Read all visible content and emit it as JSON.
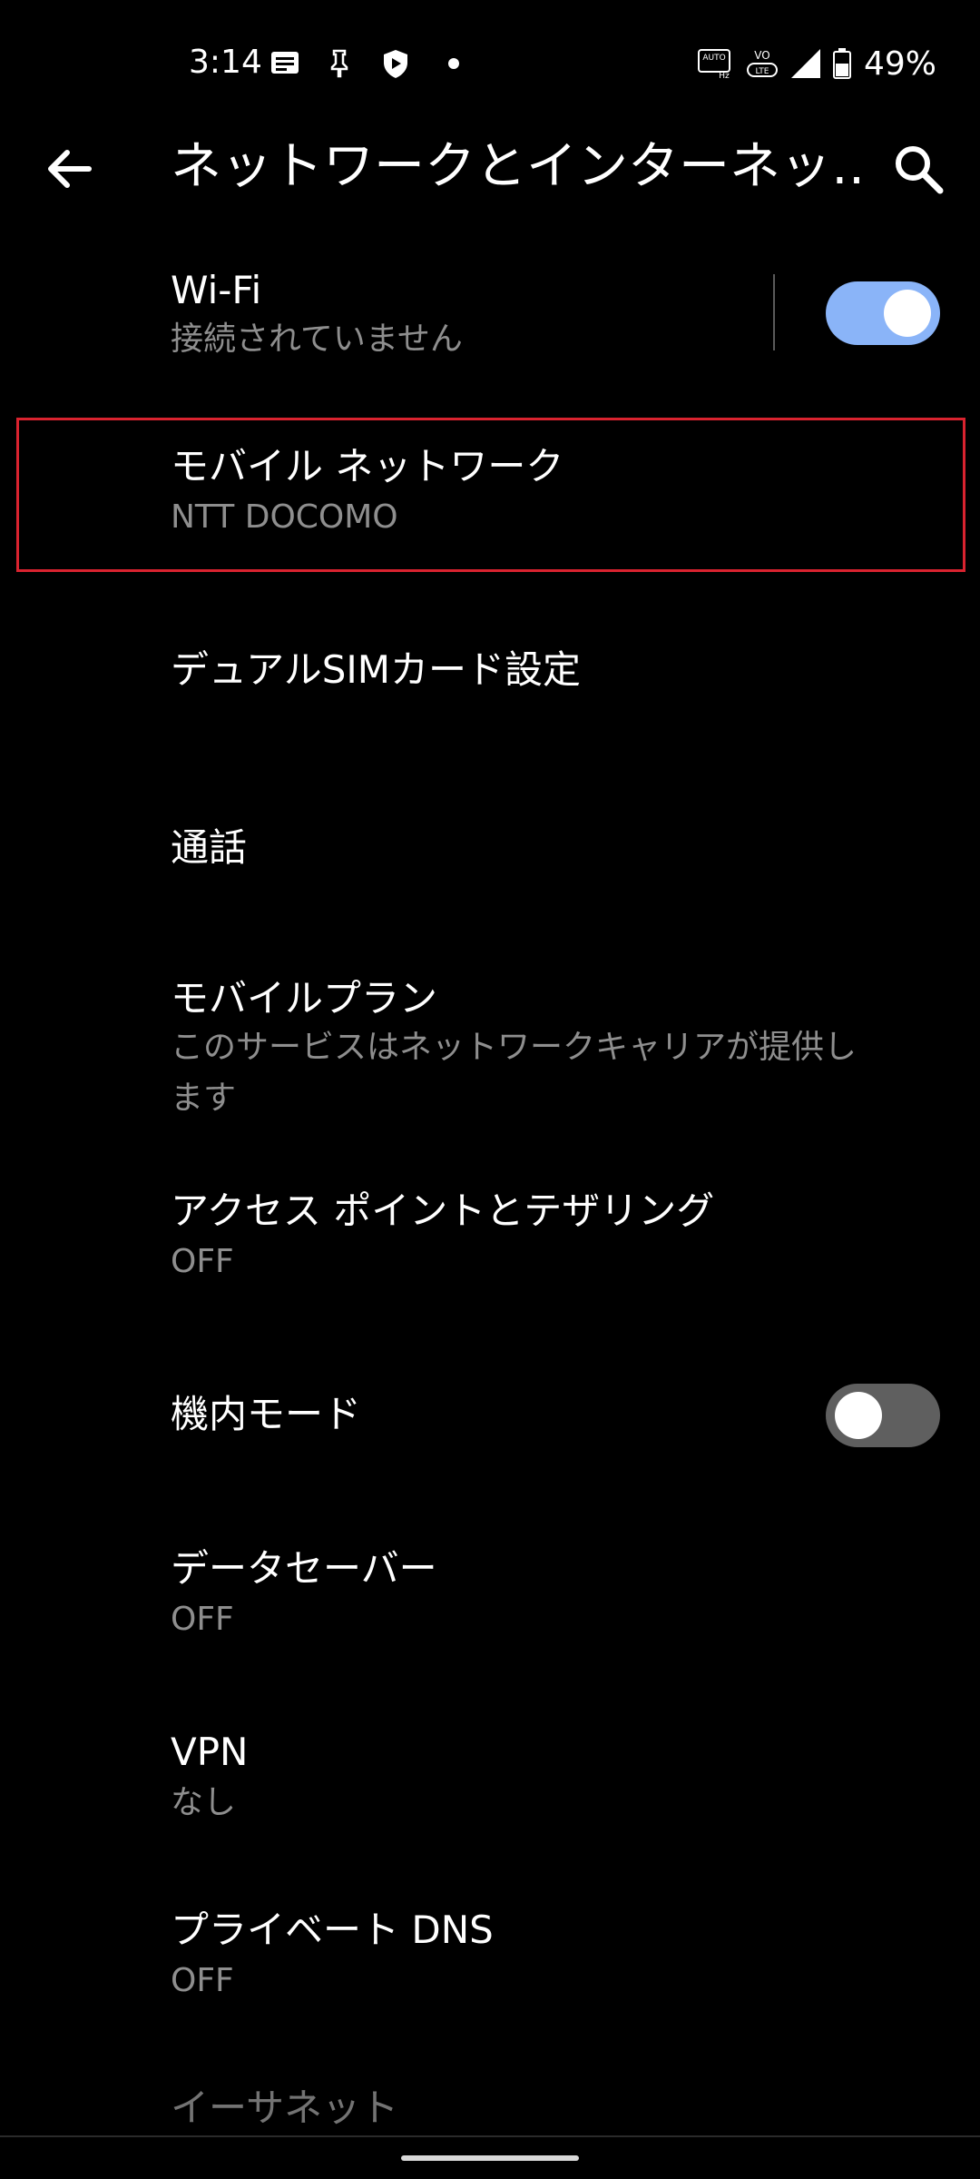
{
  "status_bar": {
    "time": "3:14",
    "battery_percent": "49%",
    "icons": [
      "message-icon",
      "pin-icon",
      "shield-icon",
      "dot-icon",
      "auto-hz-icon",
      "volte-icon",
      "signal-icon",
      "battery-icon"
    ]
  },
  "toolbar": {
    "title": "ネットワークとインターネッ…",
    "back_icon": "arrow-back-icon",
    "search_icon": "search-icon"
  },
  "settings": {
    "wifi": {
      "title": "Wi-Fi",
      "summary": "接続されていません",
      "toggle_on": true
    },
    "mobile_network": {
      "title": "モバイル ネットワーク",
      "summary": "NTT DOCOMO"
    },
    "dual_sim": {
      "title": "デュアルSIMカード設定"
    },
    "calls": {
      "title": "通話"
    },
    "mobile_plan": {
      "title": "モバイルプラン",
      "summary_line1": "このサービスはネットワークキャリアが提供し",
      "summary_line2": "ます"
    },
    "hotspot": {
      "title": "アクセス ポイントとテザリング",
      "summary": "OFF"
    },
    "airplane": {
      "title": "機内モード",
      "toggle_on": false
    },
    "data_saver": {
      "title": "データセーバー",
      "summary": "OFF"
    },
    "vpn": {
      "title": "VPN",
      "summary": "なし"
    },
    "private_dns": {
      "title": "プライベート DNS",
      "summary": "OFF"
    },
    "ethernet": {
      "title": "イーサネット"
    }
  },
  "colors": {
    "background": "#000000",
    "accent_toggle_track": "#8ab4f8",
    "toggle_off_track": "#5f5f5f",
    "highlight": "#d9232f",
    "summary_text": "#8e8e8e"
  }
}
